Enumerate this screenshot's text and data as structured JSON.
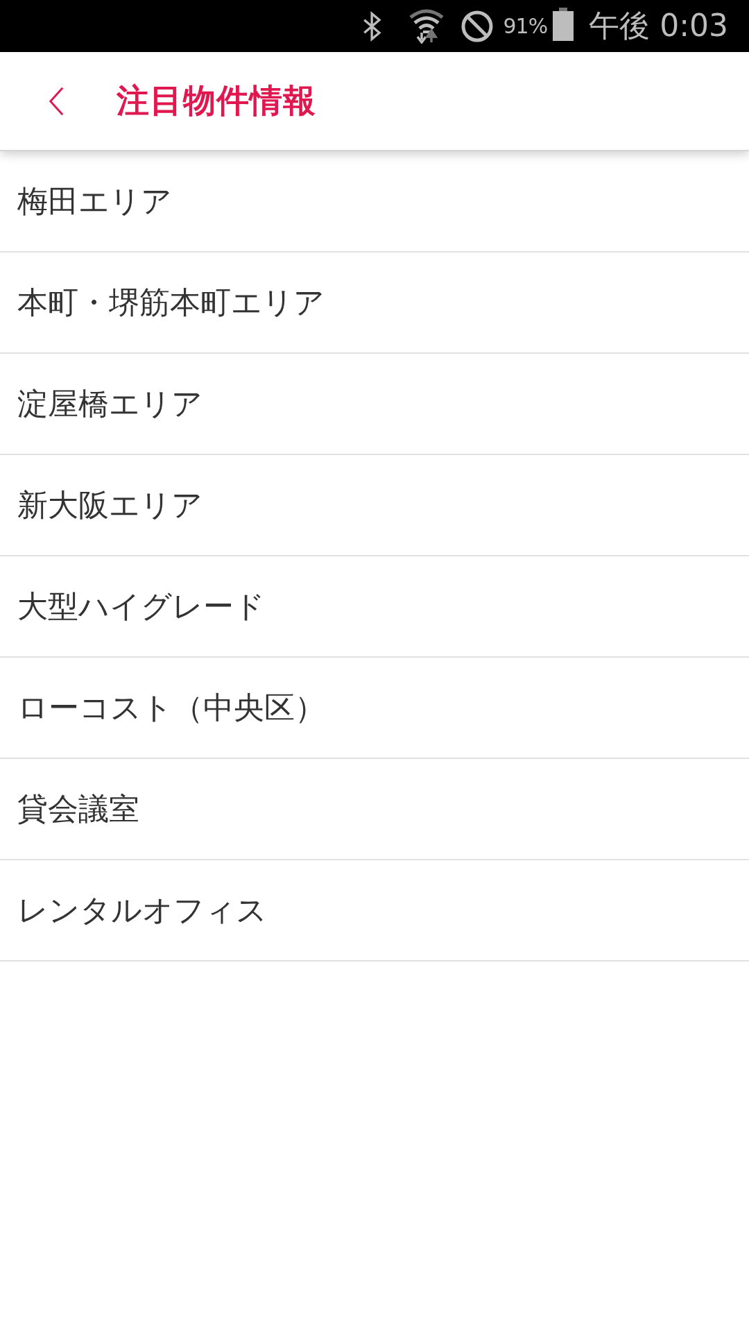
{
  "status_bar": {
    "battery_text": "91%",
    "time": "午後 0:03"
  },
  "header": {
    "title": "注目物件情報"
  },
  "list": {
    "items": [
      {
        "label": "梅田エリア"
      },
      {
        "label": "本町・堺筋本町エリア"
      },
      {
        "label": "淀屋橋エリア"
      },
      {
        "label": "新大阪エリア"
      },
      {
        "label": "大型ハイグレード"
      },
      {
        "label": "ローコスト（中央区）"
      },
      {
        "label": "貸会議室"
      },
      {
        "label": "レンタルオフィス"
      }
    ]
  }
}
